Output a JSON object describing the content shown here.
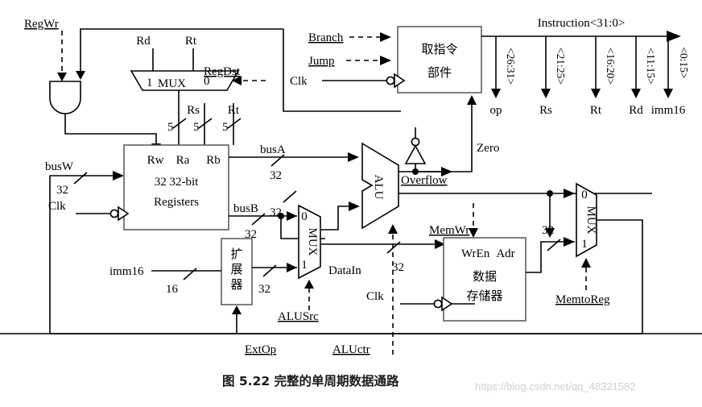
{
  "figure": {
    "caption": "图 5.22   完整的单周期数据通路",
    "watermark": "https://blog.csdn.net/qq_48321582"
  },
  "control_signals": {
    "reg_wr": "RegWr",
    "reg_dst": "RegDst",
    "branch": "Branch",
    "jump": "Jump",
    "ext_op": "ExtOp",
    "alu_src": "ALUSrc",
    "alu_ctr": "ALUctr",
    "mem_wr": "MemWr",
    "mem_to_reg": "MemtoReg"
  },
  "clock_labels": {
    "fetch_clk": "Clk",
    "regfile_clk": "Clk",
    "memory_clk": "Clk"
  },
  "fetch_unit": {
    "line1": "取指令",
    "line2": "部件"
  },
  "instruction_bus": {
    "label": "Instruction<31:0>",
    "fields": [
      {
        "bits": "<26:31>",
        "name": "op"
      },
      {
        "bits": "<21:25>",
        "name": "Rs"
      },
      {
        "bits": "<16:20>",
        "name": "Rt"
      },
      {
        "bits": "<11:15>",
        "name": "Rd"
      },
      {
        "bits": "<0:15>",
        "name": "imm16"
      }
    ]
  },
  "regdst_mux": {
    "input_top_left": "Rd",
    "input_top_right": "Rt",
    "sel_left": "1",
    "name": "MUX",
    "sel_right": "0"
  },
  "register_file": {
    "port_rw": "Rw",
    "port_ra": "Ra",
    "port_rb": "Rb",
    "line1": "32 32-bit",
    "line2": "Registers",
    "label_rs": "Rs",
    "label_rt": "Rt",
    "width_rw": "5",
    "width_ra": "5",
    "width_rb": "5",
    "bus_w": "busW",
    "bus_w_width": "32",
    "bus_a": "busA",
    "bus_a_width": "32",
    "bus_b": "busB",
    "bus_b_width": "32"
  },
  "extender": {
    "input": "imm16",
    "input_width": "16",
    "glyph": "扩展器",
    "output_width": "32"
  },
  "alusrc_mux": {
    "sel_top": "0",
    "name": "MUX",
    "sel_bottom": "1",
    "output_label": "DataIn",
    "output_width": "32"
  },
  "alu": {
    "name": "ALU",
    "overflow": "Overflow",
    "zero": "Zero",
    "result_width": "32"
  },
  "data_memory": {
    "port_wren": "WrEn",
    "port_adr": "Adr",
    "line1": "数据",
    "line2": "存储器",
    "out_width": "32"
  },
  "memtoreg_mux": {
    "sel_top": "0",
    "name": "MUX",
    "sel_bottom": "1"
  }
}
